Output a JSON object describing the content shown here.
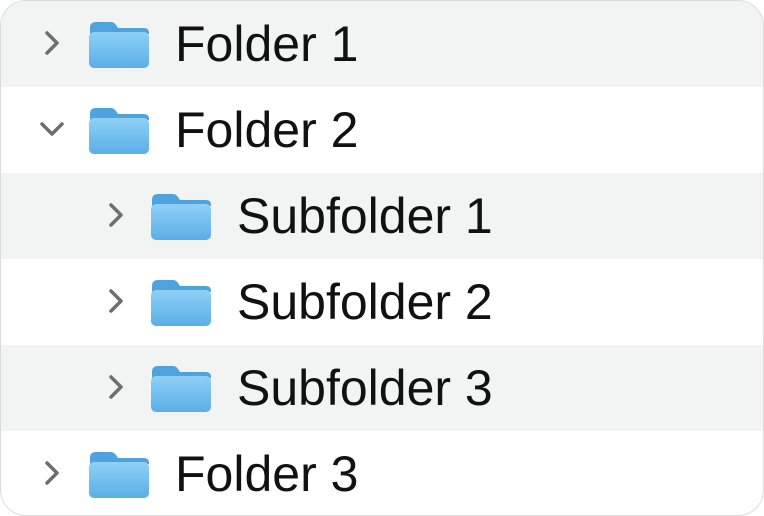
{
  "tree": {
    "rows": [
      {
        "label": "Folder 1",
        "level": 0,
        "expanded": false,
        "chevron_icon": "chevron-right-icon",
        "folder_icon": "folder-icon"
      },
      {
        "label": "Folder 2",
        "level": 0,
        "expanded": true,
        "chevron_icon": "chevron-down-icon",
        "folder_icon": "folder-icon"
      },
      {
        "label": "Subfolder 1",
        "level": 1,
        "expanded": false,
        "chevron_icon": "chevron-right-icon",
        "folder_icon": "folder-icon"
      },
      {
        "label": "Subfolder 2",
        "level": 1,
        "expanded": false,
        "chevron_icon": "chevron-right-icon",
        "folder_icon": "folder-icon"
      },
      {
        "label": "Subfolder 3",
        "level": 1,
        "expanded": false,
        "chevron_icon": "chevron-right-icon",
        "folder_icon": "folder-icon"
      },
      {
        "label": "Folder 3",
        "level": 0,
        "expanded": false,
        "chevron_icon": "chevron-right-icon",
        "folder_icon": "folder-icon"
      }
    ]
  },
  "colors": {
    "folder_top": "#8fd0f6",
    "folder_bottom": "#5aaee8",
    "chevron": "#6e6e6e",
    "alt_row": "#f2f4f4"
  }
}
